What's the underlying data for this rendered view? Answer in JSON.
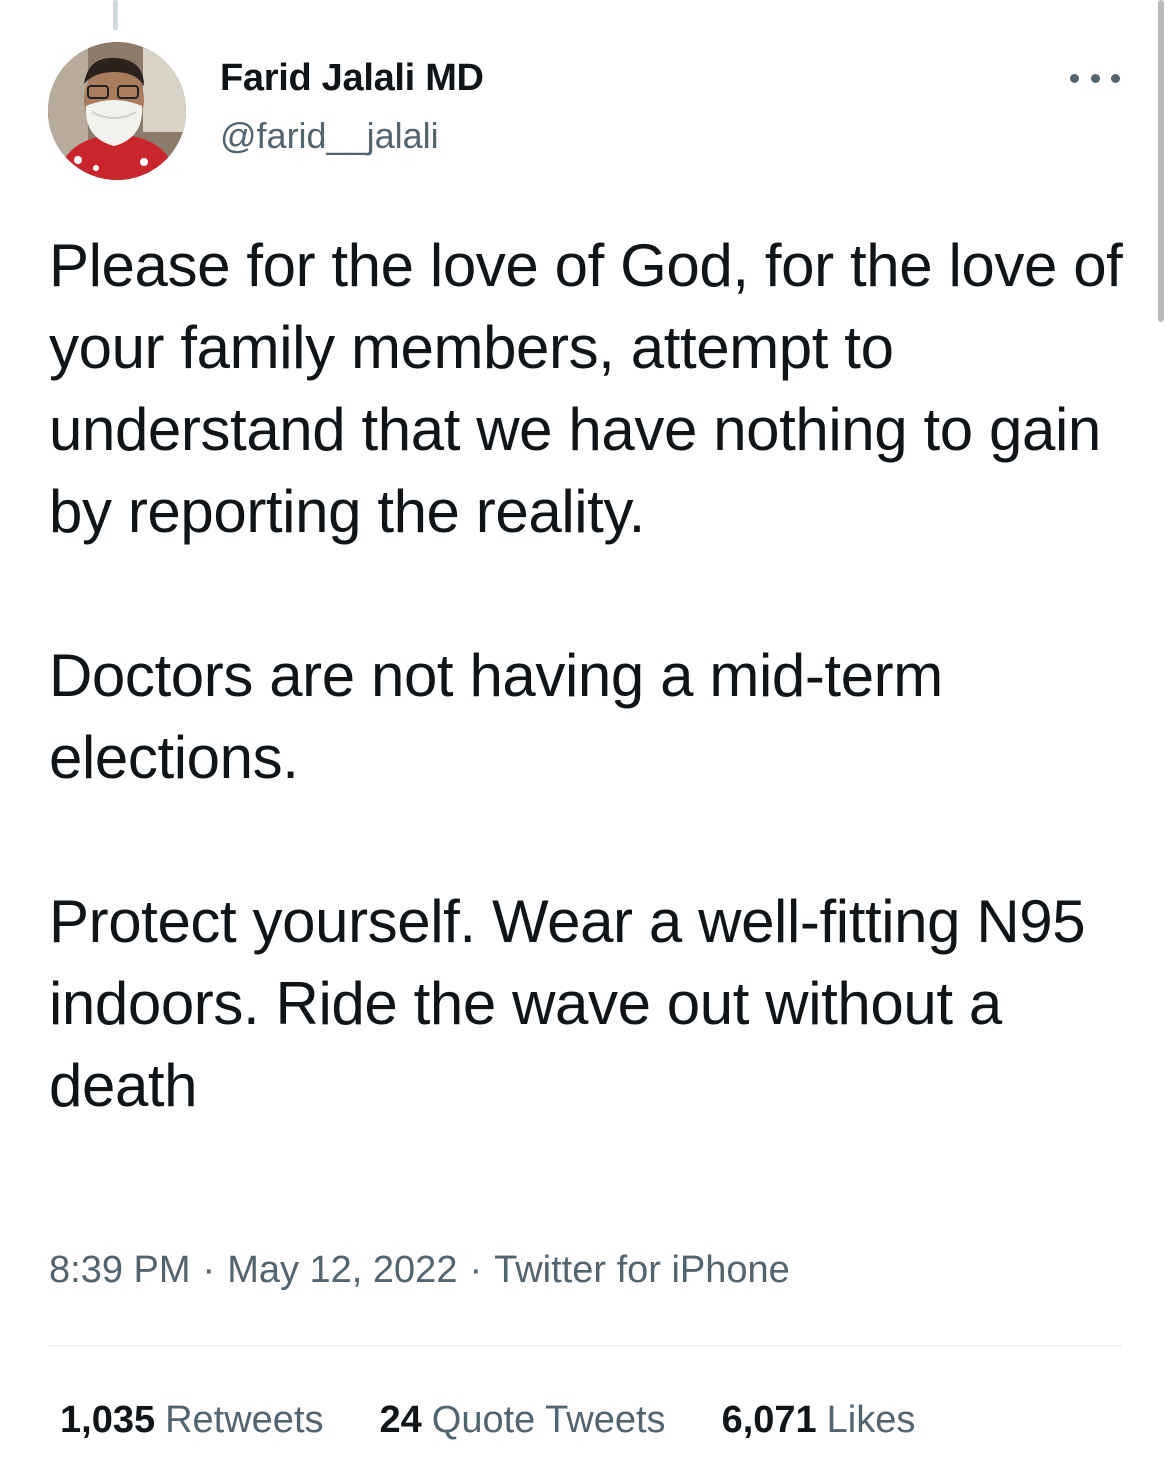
{
  "tweet": {
    "author": {
      "display_name": "Farid Jalali MD",
      "handle": "@farid__jalali"
    },
    "paragraphs": [
      "Please for the love of God, for the love of your family members, attempt to understand that we have nothing to gain by reporting the reality.",
      "Doctors are not having a mid-term elections.",
      "Protect yourself. Wear a well-fitting N95 indoors. Ride the wave out without a death"
    ],
    "time": "8:39 PM",
    "date": "May 12, 2022",
    "source": "Twitter for iPhone",
    "separator": "·",
    "stats": {
      "retweets": {
        "count": "1,035",
        "label": "Retweets"
      },
      "quote_tweets": {
        "count": "24",
        "label": "Quote Tweets"
      },
      "likes": {
        "count": "6,071",
        "label": "Likes"
      }
    }
  },
  "icons": {
    "more": "more-horizontal-icon"
  },
  "colors": {
    "text": "#0f1419",
    "secondary": "#536471",
    "divider": "#eff3f4"
  }
}
